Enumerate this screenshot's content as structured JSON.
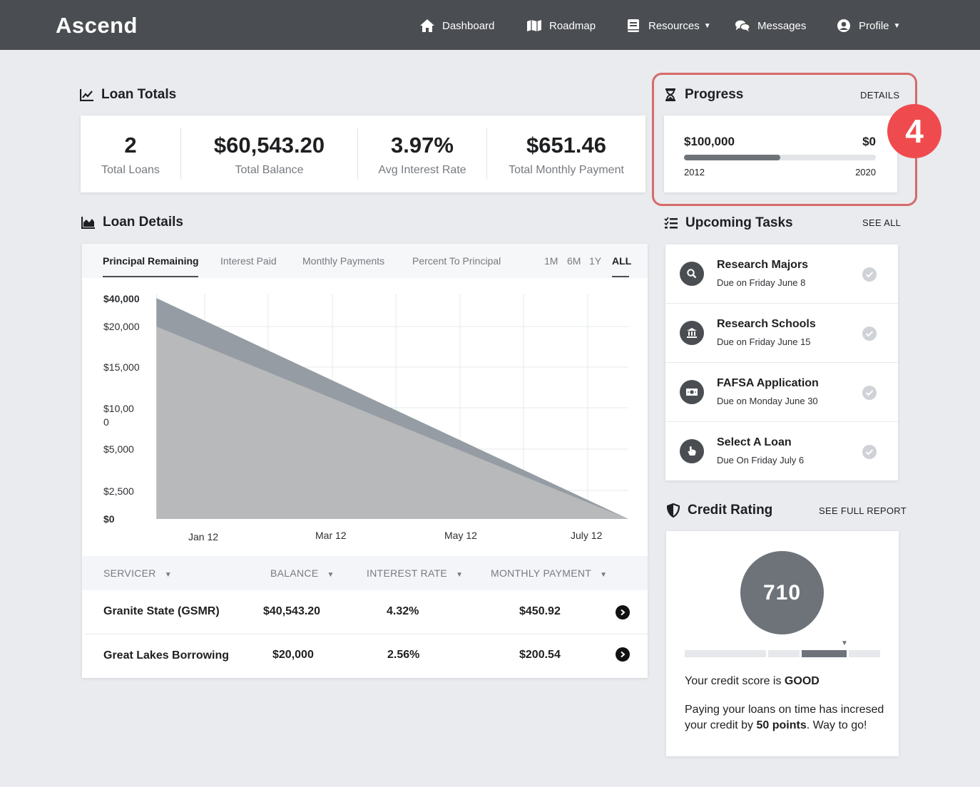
{
  "nav": {
    "brand": "Ascend",
    "items": [
      {
        "label": "Dashboard"
      },
      {
        "label": "Roadmap"
      },
      {
        "label": "Resources"
      },
      {
        "label": "Messages"
      },
      {
        "label": "Profile"
      }
    ]
  },
  "loan_totals": {
    "title": "Loan Totals",
    "stats": [
      {
        "value": "2",
        "label": "Total Loans"
      },
      {
        "value": "$60,543.20",
        "label": "Total Balance"
      },
      {
        "value": "3.97%",
        "label": "Avg Interest Rate"
      },
      {
        "value": "$651.46",
        "label": "Total Monthly Payment"
      }
    ]
  },
  "progress": {
    "title": "Progress",
    "link": "DETAILS",
    "start_amount": "$100,000",
    "end_amount": "$0",
    "start_year": "2012",
    "end_year": "2020",
    "fraction": 0.5,
    "step_badge": "4"
  },
  "loan_details": {
    "title": "Loan Details",
    "tabs": [
      "Principal Remaining",
      "Interest Paid",
      "Monthly Payments",
      "Percent To Principal"
    ],
    "active_tab": "Principal Remaining",
    "ranges": [
      "1M",
      "6M",
      "1Y",
      "ALL"
    ],
    "active_range": "ALL",
    "table": {
      "headers": [
        "SERVICER",
        "BALANCE",
        "INTEREST RATE",
        "MONTHLY PAYMENT"
      ],
      "rows": [
        {
          "servicer": "Granite State (GSMR)",
          "balance": "$40,543.20",
          "rate": "4.32%",
          "payment": "$450.92"
        },
        {
          "servicer": "Great Lakes Borrowing",
          "balance": "$20,000",
          "rate": "2.56%",
          "payment": "$200.54"
        }
      ]
    }
  },
  "chart_data": {
    "type": "area",
    "x": [
      "Jan 12",
      "Mar 12",
      "May 12",
      "July 12"
    ],
    "y_tick_labels": [
      "$40,000",
      "$20,000",
      "$15,000",
      "$10,00\n0",
      "$5,000",
      "$2,500",
      "$0"
    ],
    "series": [
      {
        "values": [
          40000,
          0
        ],
        "color": "#959ca3"
      },
      {
        "values": [
          20000,
          0
        ],
        "color": "#b8b9bb"
      }
    ],
    "grid": true,
    "legend": "none"
  },
  "tasks": {
    "title": "Upcoming Tasks",
    "link": "SEE ALL",
    "items": [
      {
        "name": "Research Majors",
        "due": "Due on Friday June 8",
        "icon": "search-icon"
      },
      {
        "name": "Research Schools",
        "due": "Due on Friday June 15",
        "icon": "bank-icon"
      },
      {
        "name": "FAFSA Application",
        "due": "Due on Monday June 30",
        "icon": "money-icon"
      },
      {
        "name": "Select A Loan",
        "due": "Due On Friday July 6",
        "icon": "pointer-hand-icon"
      }
    ]
  },
  "credit": {
    "title": "Credit Rating",
    "link": "SEE FULL REPORT",
    "score": "710",
    "rating_prefix": "Your credit score is ",
    "rating": "GOOD",
    "message_start": "Paying your loans on time has incresed your credit by ",
    "message_bold": "50 points",
    "message_end": ". Way to go!"
  },
  "colors": {
    "nav_bg": "#4a4d51",
    "accent_red": "#ef4b4e",
    "chart_dark": "#959ca3",
    "chart_light": "#b8b9bb"
  }
}
